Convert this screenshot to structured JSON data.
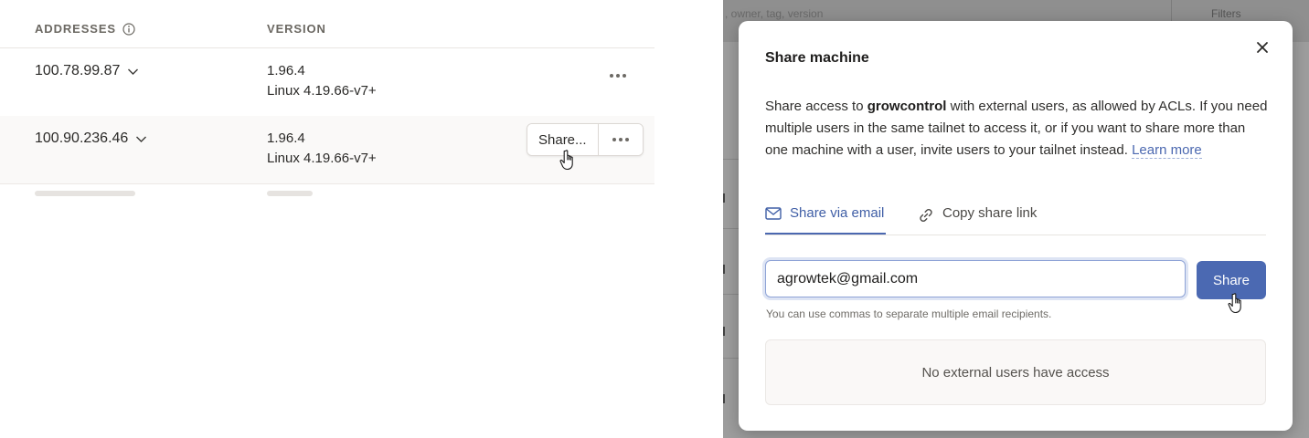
{
  "table": {
    "headers": {
      "addresses": "ADDRESSES",
      "version": "VERSION"
    },
    "rows": [
      {
        "address": "100.78.99.87",
        "version": "1.96.4",
        "os": "Linux 4.19.66-v7+"
      },
      {
        "address": "100.90.236.46",
        "version": "1.96.4",
        "os": "Linux 4.19.66-v7+",
        "share_label": "Share..."
      }
    ]
  },
  "background": {
    "search_fragment": ", owner, tag, version",
    "filters_fragment": "Filters"
  },
  "modal": {
    "title": "Share machine",
    "desc_pre": "Share access to ",
    "machine_name": "growcontrol",
    "desc_post": " with external users, as allowed by ACLs. If you need multiple users in the same tailnet to access it, or if you want to share more than one machine with a user, invite users to your tailnet instead. ",
    "learn_more": "Learn more",
    "tabs": {
      "email": "Share via email",
      "link": "Copy share link"
    },
    "email_value": "agrowtek@gmail.com",
    "share_button": "Share",
    "hint": "You can use commas to separate multiple email recipients.",
    "empty_state": "No external users have access"
  },
  "colors": {
    "accent": "#4b69b2",
    "link": "#4b68b0",
    "overlay": "#9e9e9e"
  }
}
